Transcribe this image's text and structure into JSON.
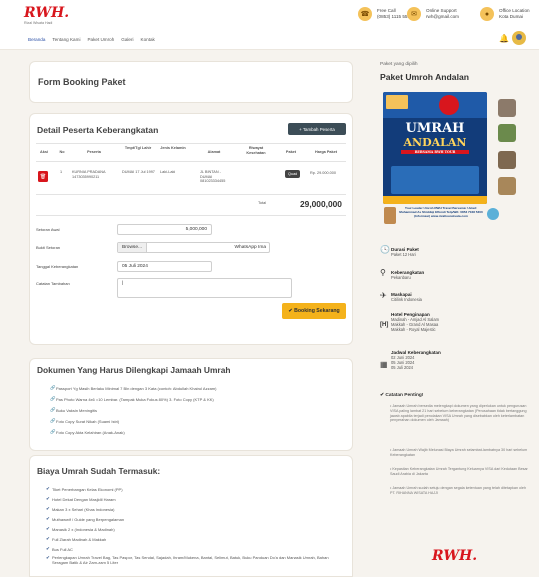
{
  "brand": {
    "logo": "RWH.",
    "tagline": "Rizal Wisata Hadi"
  },
  "header": {
    "call": {
      "line1": "Free Call",
      "line2": "(0853) 1115 5555"
    },
    "support": {
      "line1": "Online Support",
      "line2": "rwh@gmail.com"
    },
    "office": {
      "line1": "Office Location",
      "line2": "Kota Dumai"
    }
  },
  "nav": [
    "Beranda",
    "Tentang Kami",
    "Paket Umroh",
    "Galeri",
    "Kontak"
  ],
  "booking": {
    "title": "Form Booking Paket"
  },
  "participants": {
    "title": "Detail Peserta Keberangkatan",
    "add_label": "+ Tambah Peserta",
    "columns": [
      "Aksi",
      "No",
      "Peserta",
      "Tmpt/Tgl Lahir",
      "Jenis Kelamin",
      "Alamat",
      "Riwayat Kesehatan",
      "Paket",
      "Harga Paket"
    ],
    "rows": [
      {
        "no": "1",
        "name": "KURNIA PRADANA",
        "id": "1473035990211",
        "birth": "DUMAI 17 Jul 1997",
        "gender": "Laki-Laki",
        "address": "JL BINTAN - DUMAI 081023334455",
        "health": "",
        "package": "Quad",
        "price": "Rp. 29.000.000"
      }
    ],
    "total_label": "Total",
    "total_value": "29,000,000"
  },
  "form": {
    "dp_label": "Setoran Awal",
    "dp_value": "5,000,000",
    "proof_label": "Bukti Setoran",
    "browse": "Browse...",
    "file_name": "WhatsApp Ima",
    "date_label": "Tanggal Keberangkatan",
    "date_value": "05 Juli 2024",
    "notes_label": "Catatan Tambahan",
    "notes_value": "|",
    "submit": "✔ Booking Sekarang"
  },
  "documents": {
    "title": "Dokumen Yang Harus Dilengkapi Jamaah Umrah",
    "items": [
      "Passport Yg Masih Berlaku Minimal 7 Bln dengan 3 Kata (contoh: Abdullah Khairul Azzam)",
      "Pas Photo Warna 4x6 =10 Lembar. (Tampak Muka Fokus 80%) 3. Foto Copy (KTP & KK)",
      "Buku Vaksin Meningitis",
      "Foto Copy Surat Nikah (Suami Istri)",
      "Foto Copy Akta Kelahiran (Anak-Anak)"
    ]
  },
  "includes": {
    "title": "Biaya Umrah Sudah Termasuk:",
    "items": [
      "Tiket Penerbangan Kelas Ekonomi (PP)",
      "Hotel Dekat Dengan Masjidil Haram",
      "Makan 3 x Sehari (Khas Indonesia)",
      "Muthawwif / Guide yang Berpengalaman",
      "Manasik 2 x (Indonesia & Madinah)",
      "Full Ziarah Madinah & Makkah",
      "Bus Full AC",
      "Perlengkapan Umrah Travel Bag, Tas Paspor, Tas Sendal, Sajadah, Ihram/Mukena, Bantal, Selimut, Batuk, Buku Panduan Do'a dan Manasik Umrah, Bahan Seragam Batik & Air Zam-zam 5 Liter"
    ]
  },
  "sidebar": {
    "label": "Paket yang dipilih",
    "package_name": "Paket Umroh Andalan",
    "poster": {
      "top_text": "UMRAH",
      "main_text": "ANDALAN",
      "sub_text": "BERSAMA RWH TOUR",
      "footer": "Tour Leader Umroh RWH Travel Bersama: Ustad: Muhammad As Shiddiqi Effendi Telp/WA: 0853 7048 5300 (Informasi) www.rizaltourwisata.com"
    },
    "details": [
      {
        "icon": "clock-icon",
        "title": "Durasi Paket",
        "lines": [
          "Paket 12 Hari"
        ]
      },
      {
        "icon": "location-icon",
        "title": "Keberangkatan",
        "lines": [
          "Pekanbaru"
        ]
      },
      {
        "icon": "plane-icon",
        "title": "Maskapai",
        "lines": [
          "Citilink Indonesia"
        ]
      },
      {
        "icon": "hotel-icon",
        "title": "Hotel Penginapan",
        "lines": [
          "Madinah - Amjad Al Salam",
          "Makkah - Grand Al Masaa",
          "Makkah - Royal Majestic"
        ]
      },
      {
        "icon": "calendar-icon",
        "title": "Jadwal Keberangkatan",
        "lines": [
          "02 Juni 2024",
          "05 Juni 2024",
          "05 Juli 2024"
        ]
      }
    ],
    "notes_title": "✔ Catatan Penting!",
    "notes": [
      "Jamaah Umrah bersedia melengkapi dokumen yang diperlukan untuk pengurusan VISA paling lambat 21 hari sebelum keberangkatan (Perusahaan tidak bertanggung jawab apabila terjadi penolakan VISA Umrah yang disebabkan oleh keterlambatan penyerahan dokumen oleh Jamaah)",
      "Jamaah Umrah Wajib Melunasi Biaya Umrah selambat-lambatnya 30 hari sebelum Keberangkatan",
      "Kepastian Keberangkatan Umrah Tergantung Keluarnya VISA dari Kedutaan Besar Saudi Arabia di Jakarta",
      "Jamaah Umrah sudah setuju dengan segala ketentuan yang telah ditetapkan oleh PT. RIHANNA WISATA HAJJI"
    ],
    "footer_logo": "RWH."
  },
  "colors": {
    "accent": "#f4b21b",
    "brand": "#d8161d",
    "navy": "#2a4f86"
  }
}
